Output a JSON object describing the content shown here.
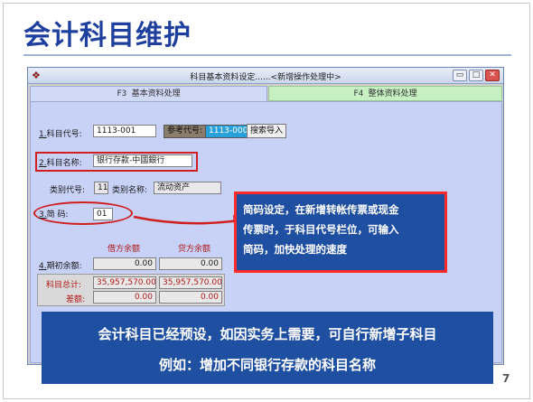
{
  "slide": {
    "title": "会计科目维护",
    "page_number": "7"
  },
  "window": {
    "title": "科目基本资料设定......<新增操作处理中>",
    "min_glyph": "▭",
    "max_glyph": "□",
    "close_glyph": "✕"
  },
  "tabs": [
    {
      "label": "F3 基本资料处理"
    },
    {
      "label": "F4 整体资料处理"
    }
  ],
  "form": {
    "account_code": {
      "label_key": "1.",
      "label": "科目代号:",
      "value": "1113-001"
    },
    "reference_code": {
      "label": "参考代号:",
      "value": "1113-000",
      "button": "搜索导入"
    },
    "account_name": {
      "label_key": "2.",
      "label": "科目名称:",
      "value": "银行存款-中國銀行"
    },
    "category": {
      "label": "类别代号:",
      "value": "11",
      "name_label": "类别名称:",
      "name_value": "流动资产"
    },
    "short_code": {
      "label_key": "3.",
      "label": "简    码:",
      "value": "01"
    },
    "balances": {
      "debit_header": "借方余额",
      "credit_header": "贷方余额",
      "opening": {
        "label_key": "4.",
        "label": "期初余额:",
        "debit": "0.00",
        "credit": "0.00"
      },
      "total": {
        "label": "科目总计:",
        "debit": "35,957,570.00",
        "credit": "35,957,570.00"
      },
      "difference": {
        "label": "差额:",
        "debit": "0.00",
        "credit": "0.00"
      }
    }
  },
  "callout": {
    "line1": "简码设定，在新增转帐传票或现金",
    "line2": "传票时，于科目代号栏位，可输入",
    "line3": "简码，加快处理的速度"
  },
  "banner": {
    "line1": "会计科目已经预设，如因实务上需要，可自行新增子科目",
    "line2": "例如：增加不同银行存款的科目名称"
  },
  "colors": {
    "title_blue": "#1f3f9e",
    "callout_bg": "#1f4fa0",
    "highlight_red": "#d01f1f",
    "panel_blue": "#c7d2f6",
    "tab_green": "#c6f0c2"
  }
}
